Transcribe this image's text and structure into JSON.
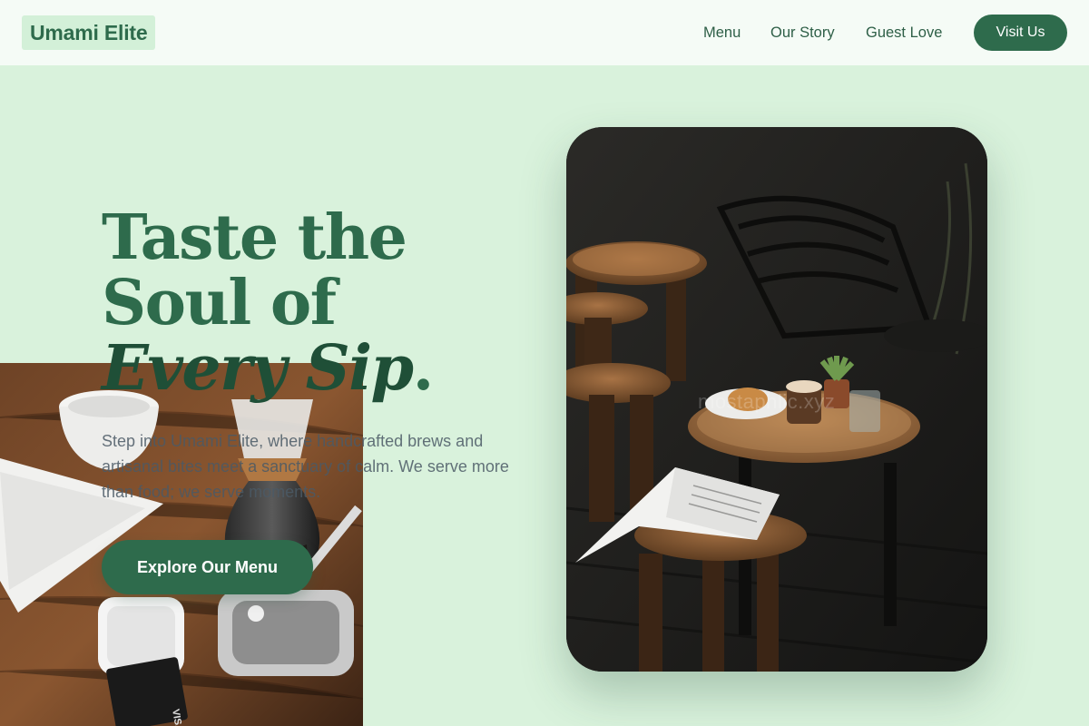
{
  "brand": {
    "name": "Umami Elite"
  },
  "nav": {
    "links": [
      "Menu",
      "Our Story",
      "Guest Love"
    ],
    "cta_label": "Visit Us"
  },
  "hero": {
    "title_line1": "Taste the",
    "title_line2": "Soul of",
    "title_line3_accent": "Every Sip",
    "title_period": ".",
    "description": "Step into Umami Elite, where handcrafted brews and artisanal bites meet a sanctuary of calm. We serve more than food; we serve moments.",
    "cta_label": "Explore Our Menu"
  },
  "images": {
    "left_photo": "coffee-chemex-photo",
    "right_photo": "cafe-table-photo",
    "right_watermark": "mostaphlic.xyz"
  },
  "colors": {
    "background": "#d9f2dc",
    "nav_background": "#f5fbf6",
    "brand_green": "#2e6b4c",
    "heading_dark_green": "#1f4f37",
    "body_text": "#4b5a66"
  }
}
